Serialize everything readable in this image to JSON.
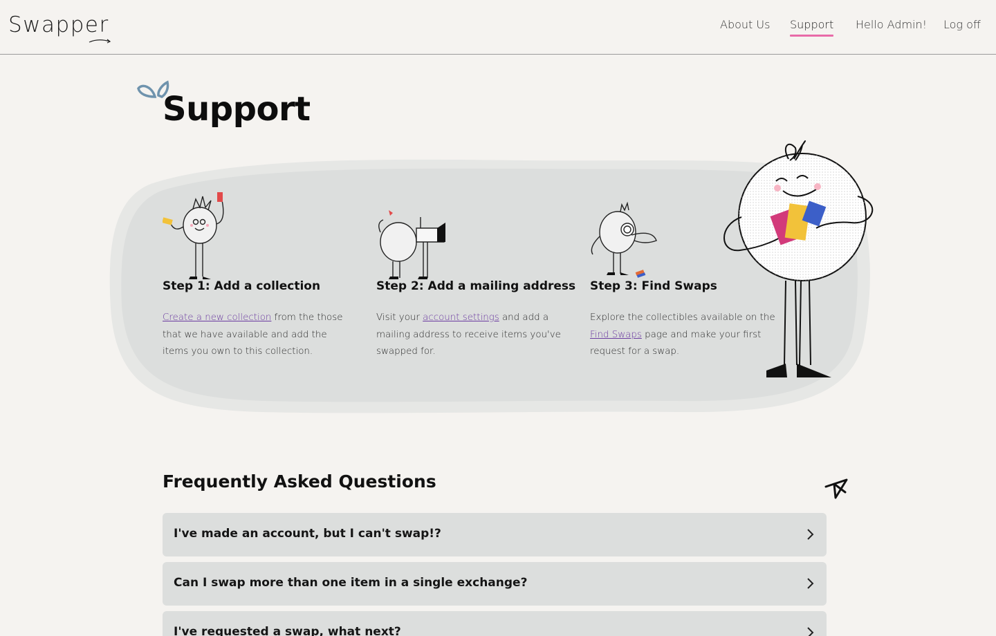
{
  "header": {
    "logo": "Swapper",
    "nav": [
      {
        "label": "About Us",
        "active": false
      },
      {
        "label": "Support",
        "active": true
      },
      {
        "label": "Hello Admin!",
        "active": false
      },
      {
        "label": "Log off",
        "active": false
      }
    ]
  },
  "page": {
    "title": "Support"
  },
  "steps": [
    {
      "title": "Step 1: Add a collection",
      "link": "Create a new collection",
      "text_before": "",
      "text_after": " from the those that we have available and add the items you own to this collection."
    },
    {
      "title": "Step 2: Add a mailing address",
      "text_before": "Visit your ",
      "link": "account settings",
      "text_after": " and add a mailing address to receive items you've swapped for."
    },
    {
      "title": "Step 3: Find Swaps",
      "text_before": "Explore the collectibles available on the ",
      "link": "Find Swaps",
      "text_after": " page and make your first request for a swap."
    }
  ],
  "faq": {
    "title": "Frequently Asked Questions",
    "items": [
      {
        "question": "I've made an account, but I can't swap!?"
      },
      {
        "question": "Can I swap more than one item in a single exchange?"
      },
      {
        "question": "I've requested a swap, what next?"
      }
    ]
  },
  "colors": {
    "background": "#f5f3f0",
    "panel": "#dcdedd",
    "accent_underline": "#e86aa8",
    "link": "#6b3aa0"
  },
  "icons": [
    "leaves-icon",
    "star-icon",
    "chevron-right-icon",
    "swoosh-icon"
  ]
}
